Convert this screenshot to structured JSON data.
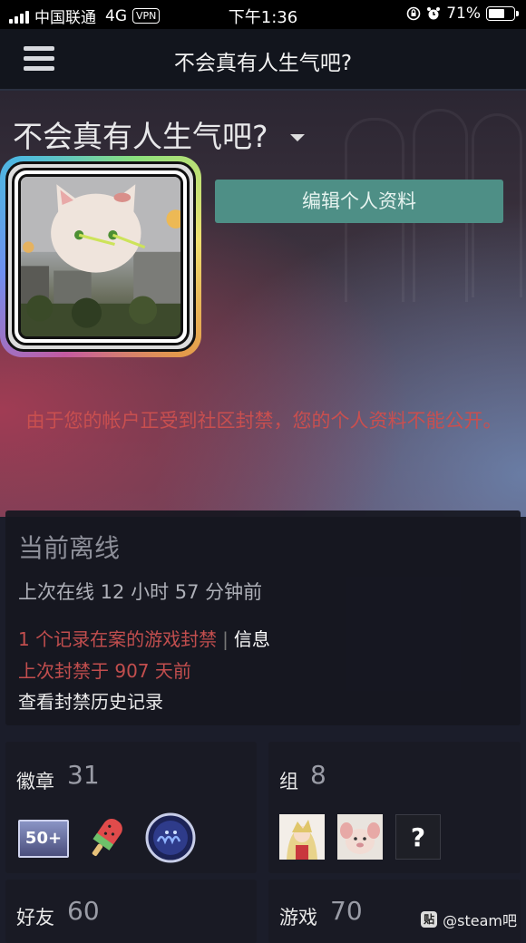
{
  "status_bar": {
    "carrier": "中国联通",
    "network": "4G",
    "vpn": "VPN",
    "time": "下午1:36",
    "battery": "71%",
    "battery_level": 0.71
  },
  "header": {
    "title": "不会真有人生气吧?"
  },
  "profile": {
    "persona_name": "不会真有人生气吧?",
    "edit_button": "编辑个人资料",
    "ban_notice": "由于您的帐户正受到社区封禁，您的个人资料不能公开。"
  },
  "status": {
    "title": "当前离线",
    "last_online": "上次在线 12 小时 57 分钟前",
    "game_ban": "1 个记录在案的游戏封禁",
    "separator": "|",
    "info_link": "信息",
    "last_ban": "上次封禁于 907 天前",
    "history_link": "查看封禁历史记录"
  },
  "tiles": {
    "badges": {
      "label": "徽章",
      "count": "31",
      "badge_text": "50+"
    },
    "groups": {
      "label": "组",
      "count": "8",
      "unknown": "?"
    },
    "friends": {
      "label": "好友",
      "count": "60"
    },
    "games": {
      "label": "游戏",
      "count": "70"
    }
  },
  "watermark": {
    "icon": "贴",
    "text": "@steam吧"
  },
  "colors": {
    "accent_button": "#4e8f86",
    "ban_red": "#c24e4e",
    "panel_bg": "#16171f"
  }
}
